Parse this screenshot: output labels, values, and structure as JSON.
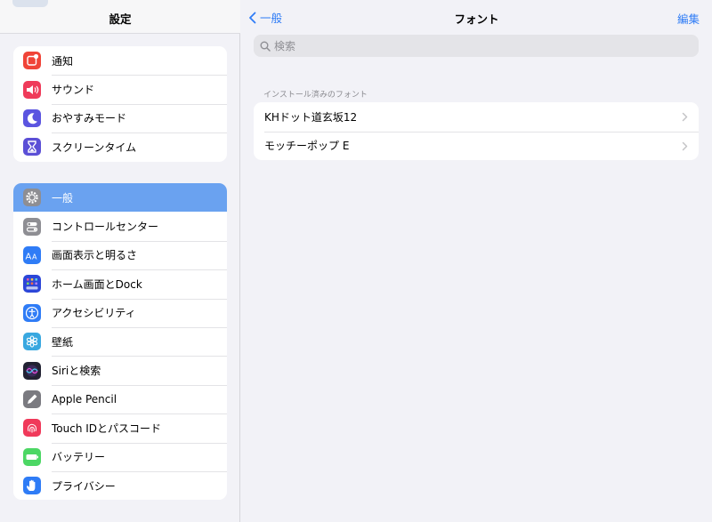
{
  "sidebar": {
    "title": "設定",
    "groups": [
      {
        "items": [
          {
            "label": "通知",
            "icon": "notifications-icon",
            "color": "#f04438"
          },
          {
            "label": "サウンド",
            "icon": "sound-icon",
            "color": "#ef3b5a"
          },
          {
            "label": "おやすみモード",
            "icon": "moon-icon",
            "color": "#5b55e0"
          },
          {
            "label": "スクリーンタイム",
            "icon": "hourglass-icon",
            "color": "#5b4fd6"
          }
        ]
      },
      {
        "items": [
          {
            "label": "一般",
            "icon": "gear-icon",
            "color": "#8e8e93",
            "selected": true
          },
          {
            "label": "コントロールセンター",
            "icon": "control-center-icon",
            "color": "#8e8e93"
          },
          {
            "label": "画面表示と明るさ",
            "icon": "display-icon",
            "color": "#2f7cf6"
          },
          {
            "label": "ホーム画面とDock",
            "icon": "home-screen-icon",
            "color": "#2c46d8"
          },
          {
            "label": "アクセシビリティ",
            "icon": "accessibility-icon",
            "color": "#2f7cf6"
          },
          {
            "label": "壁紙",
            "icon": "wallpaper-icon",
            "color": "#39a8e0"
          },
          {
            "label": "Siriと検索",
            "icon": "siri-icon",
            "color": "#222233"
          },
          {
            "label": "Apple Pencil",
            "icon": "pencil-icon",
            "color": "#7a7a80"
          },
          {
            "label": "Touch IDとパスコード",
            "icon": "fingerprint-icon",
            "color": "#f0395a"
          },
          {
            "label": "バッテリー",
            "icon": "battery-icon",
            "color": "#4cd764"
          },
          {
            "label": "プライバシー",
            "icon": "hand-icon",
            "color": "#2f7cf6"
          }
        ]
      }
    ]
  },
  "header": {
    "back_label": "一般",
    "title": "フォント",
    "edit_label": "編集"
  },
  "search": {
    "placeholder": "検索"
  },
  "fonts": {
    "section_title": "インストール済みのフォント",
    "items": [
      "KHドット道玄坂12",
      "モッチーポップ E"
    ]
  }
}
